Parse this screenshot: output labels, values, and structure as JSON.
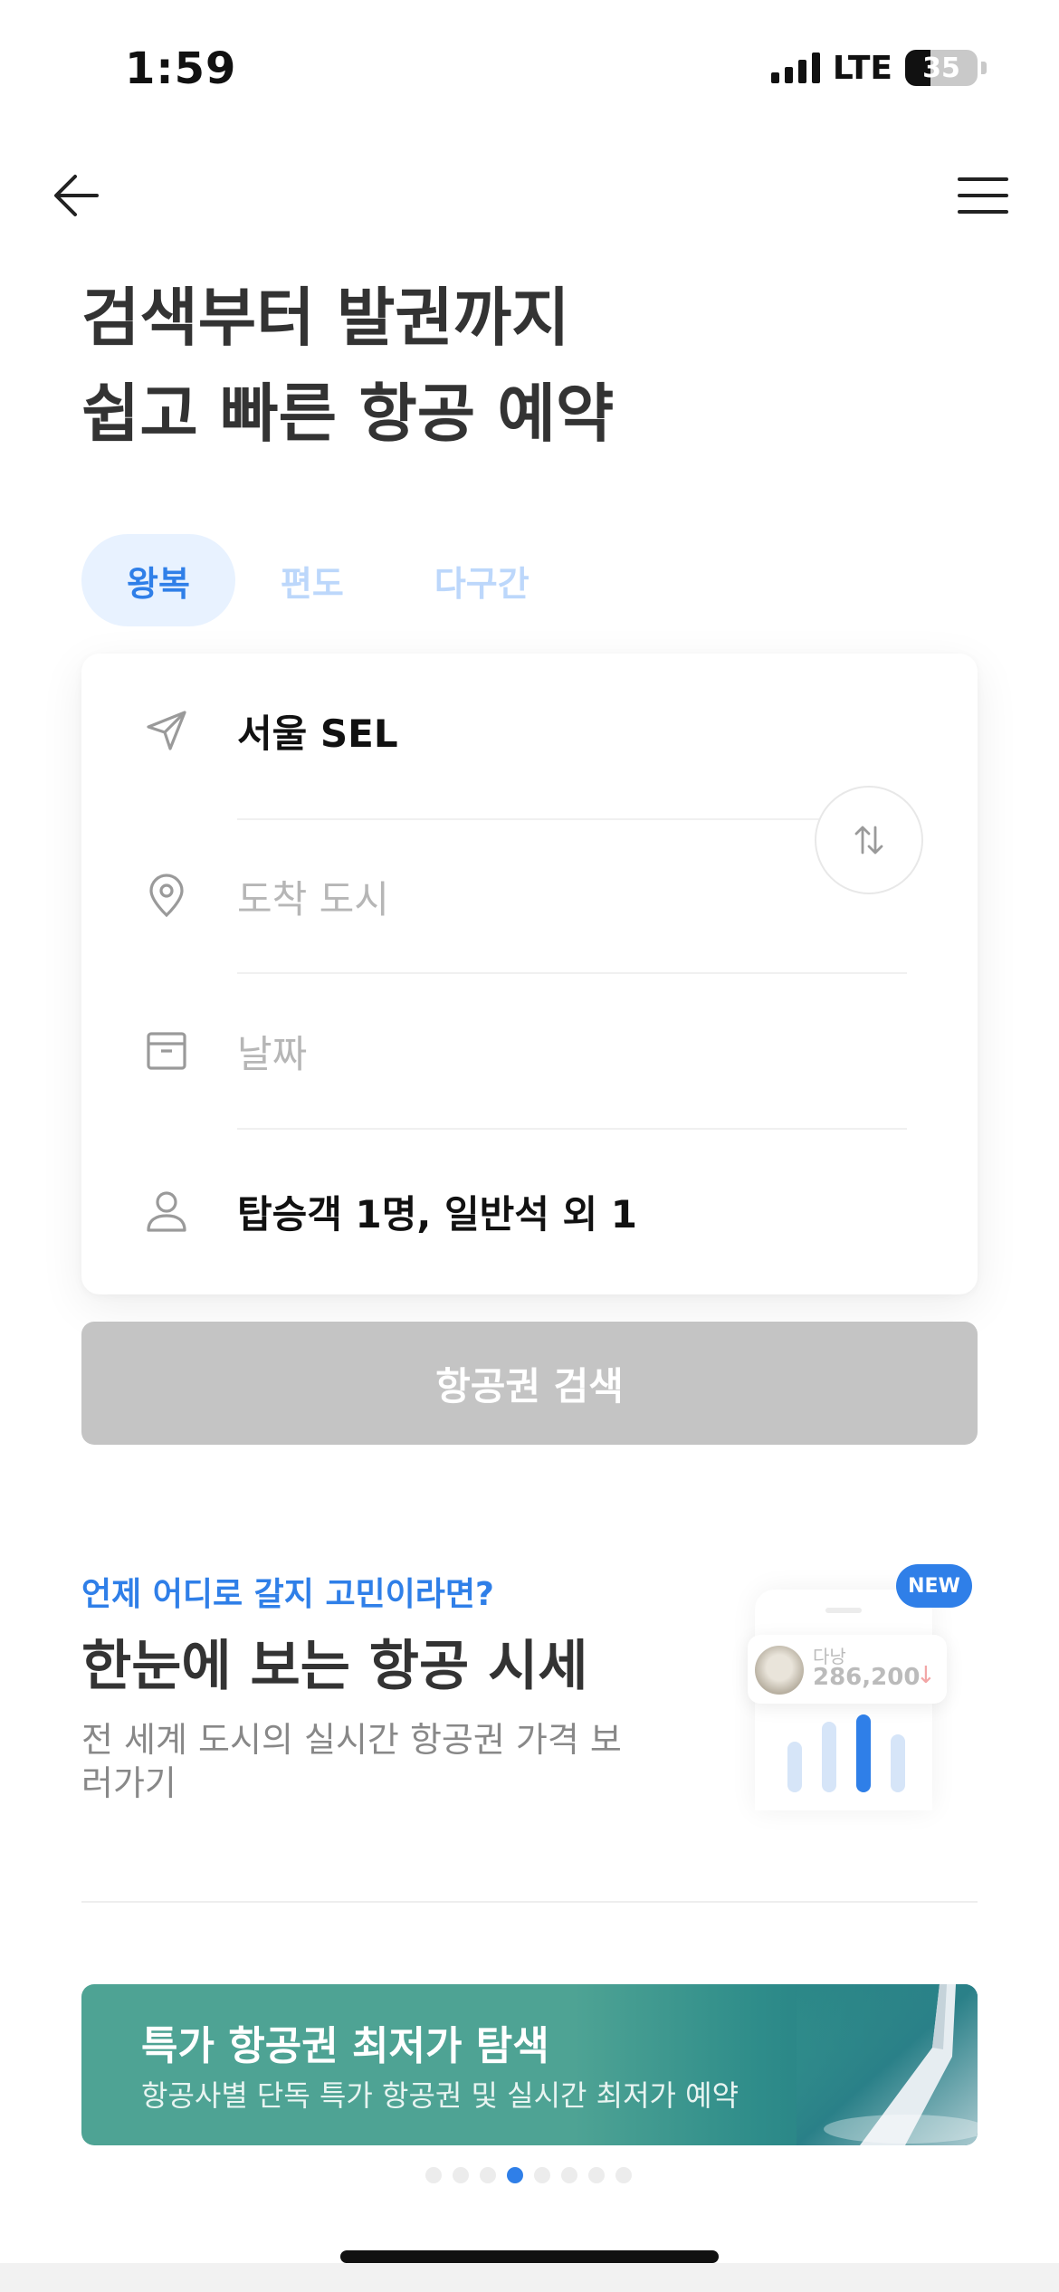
{
  "status_bar": {
    "time": "1:59",
    "network": "LTE",
    "battery": "35",
    "battery_level": 0.35
  },
  "nav": {
    "back_icon": "arrow-left-icon",
    "menu_icon": "hamburger-menu-icon"
  },
  "hero": {
    "line1": "검색부터 발권까지",
    "line2": "쉽고 빠른 항공 예약"
  },
  "trip_tabs": [
    {
      "label": "왕복",
      "active": true
    },
    {
      "label": "편도",
      "active": false
    },
    {
      "label": "다구간",
      "active": false
    }
  ],
  "search_form": {
    "departure": {
      "value": "서울 SEL",
      "icon": "paper-plane-icon"
    },
    "arrival": {
      "placeholder": "도착 도시",
      "icon": "location-pin-icon"
    },
    "date": {
      "placeholder": "날짜",
      "icon": "calendar-icon"
    },
    "passengers": {
      "value": "탑승객 1명, 일반석 외 1",
      "icon": "person-icon"
    },
    "swap_icon": "swap-arrows-icon"
  },
  "search_button": {
    "label": "항공권 검색"
  },
  "price_promo": {
    "kicker": "언제 어디로 갈지 고민이라면?",
    "title": "한눈에 보는 항공 시세",
    "description": "전 세계 도시의 실시간 항공권 가격 보러가기",
    "badge": "NEW",
    "illustration": {
      "city": "다낭",
      "price": "286,200",
      "trend": "↓"
    }
  },
  "banner": {
    "title": "특가 항공권 최저가 탐색",
    "subtitle": "항공사별 단독 특가 항공권 및 실시간 최저가 예약",
    "colors": {
      "primary": "#4ea394",
      "dark": "#1c6f7f"
    }
  },
  "carousel": {
    "total": 8,
    "active_index": 3
  },
  "colors": {
    "accent": "#2f7fe8",
    "tab_active_bg": "#e8f2ff",
    "disabled_button": "#c4c4c4"
  }
}
